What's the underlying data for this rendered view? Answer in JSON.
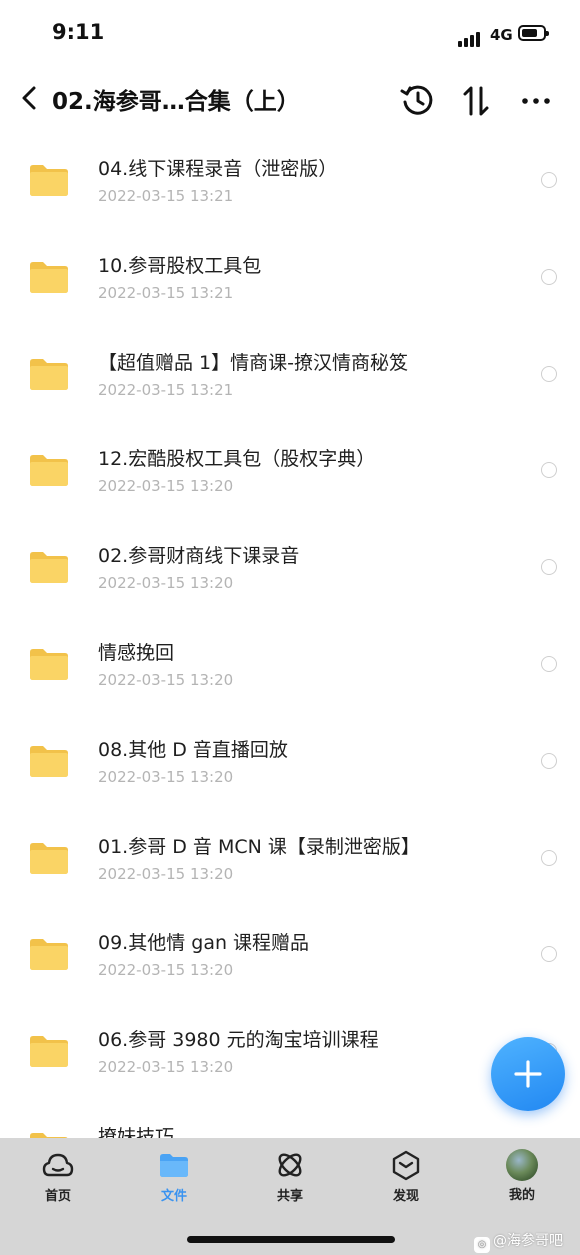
{
  "status_bar": {
    "time": "9:11",
    "network": "4G",
    "battery_level": 0.6
  },
  "header": {
    "title": "02.海参哥…合集（上）"
  },
  "files": [
    {
      "name": "04.线下课程录音（泄密版）",
      "date": "2022-03-15 13:21"
    },
    {
      "name": "10.参哥股权工具包",
      "date": "2022-03-15 13:21"
    },
    {
      "name": "【超值赠品 1】情商课-撩汉情商秘笈",
      "date": "2022-03-15 13:21"
    },
    {
      "name": "12.宏酷股权工具包（股权字典）",
      "date": "2022-03-15 13:20"
    },
    {
      "name": "02.参哥财商线下课录音",
      "date": "2022-03-15 13:20"
    },
    {
      "name": "情感挽回",
      "date": "2022-03-15 13:20"
    },
    {
      "name": "08.其他 D 音直播回放",
      "date": "2022-03-15 13:20"
    },
    {
      "name": "01.参哥 D 音 MCN 课【录制泄密版】",
      "date": "2022-03-15 13:20"
    },
    {
      "name": "09.其他情 gan 课程赠品",
      "date": "2022-03-15 13:20"
    },
    {
      "name": "06.参哥 3980 元的淘宝培训课程",
      "date": "2022-03-15 13:20"
    },
    {
      "name": "撩妹技巧",
      "date": ""
    }
  ],
  "tabbar": {
    "tabs": [
      {
        "label": "首页",
        "icon": "home-cloud-icon"
      },
      {
        "label": "文件",
        "icon": "folder-icon",
        "active": true
      },
      {
        "label": "共享",
        "icon": "share-orbit-icon"
      },
      {
        "label": "发现",
        "icon": "discover-cube-icon"
      },
      {
        "label": "我的",
        "icon": "avatar"
      }
    ]
  },
  "watermark": {
    "text": "@海参哥吧"
  },
  "colors": {
    "accent": "#3a93f0",
    "folder": "#f7cf5a",
    "tabbar_bg": "#d6d6d6",
    "date_text": "#b4b4b4"
  }
}
